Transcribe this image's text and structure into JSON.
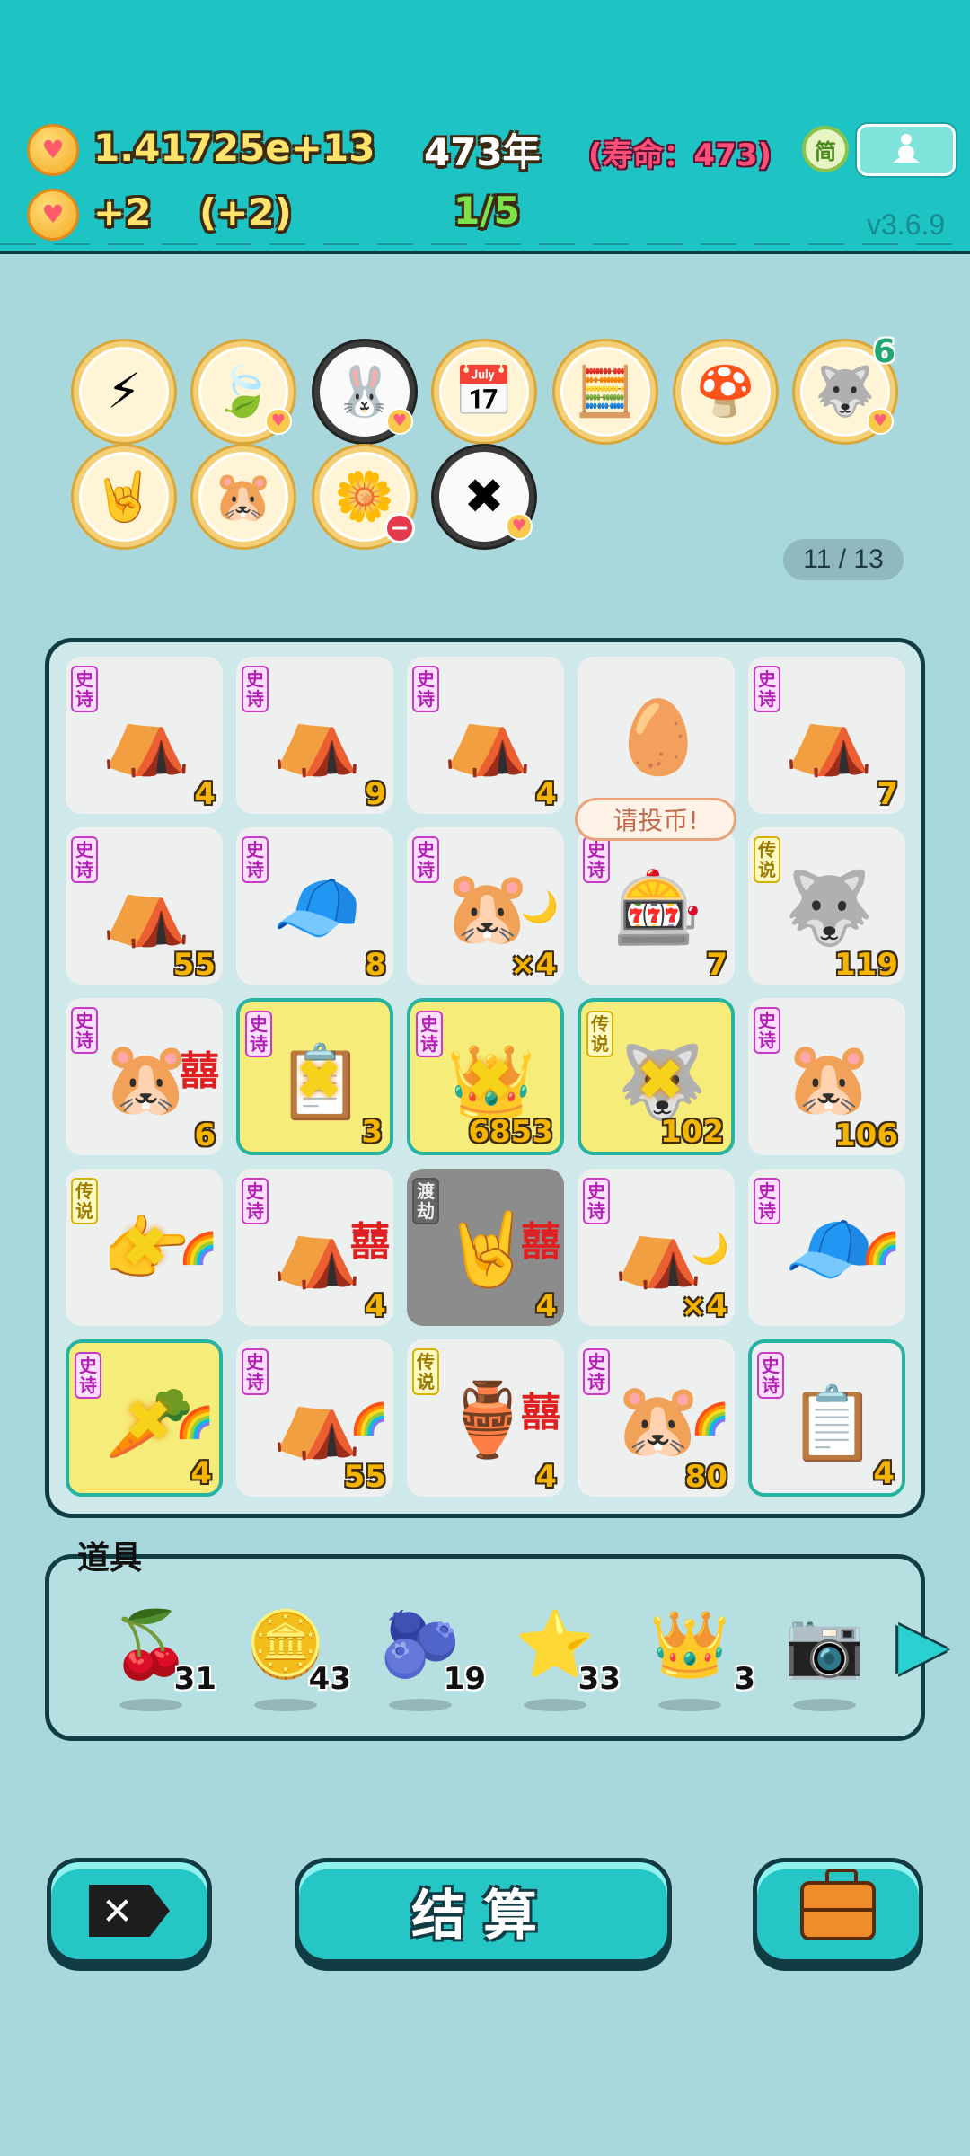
{
  "header": {
    "coins": "1.41725e+13",
    "year": "473年",
    "lifespan": "(寿命：473)",
    "income": "+2",
    "income_bonus": "(+2)",
    "progress": "1/5",
    "simp_label": "简",
    "version": "v3.6.9"
  },
  "buffs": {
    "page": "11 / 13",
    "items": [
      {
        "icon": "lightning-icon",
        "glyph": "⚡"
      },
      {
        "icon": "leaf-icon",
        "glyph": "🍃"
      },
      {
        "icon": "rabbit-icon",
        "glyph": "🐰"
      },
      {
        "icon": "calendar-icon",
        "glyph": "📅"
      },
      {
        "icon": "math-face-icon",
        "glyph": "🧮"
      },
      {
        "icon": "mushroom-cup-icon",
        "glyph": "🍄"
      },
      {
        "icon": "husky-icon",
        "glyph": "🐺",
        "count": "6"
      },
      {
        "icon": "rock-hand-icon",
        "glyph": "🤘"
      },
      {
        "icon": "gophers-icon",
        "glyph": "🐹"
      },
      {
        "icon": "flower-pot-icon",
        "glyph": "🌼"
      },
      {
        "icon": "delete-tag-icon",
        "glyph": "✖"
      }
    ]
  },
  "board": {
    "tooltip": "请投币!",
    "tags": {
      "epic": "史诗",
      "legend": "传说",
      "robbery": "渡劫"
    },
    "cells": [
      {
        "tag": "epic",
        "icon": "tent-rabbit-icon",
        "glyph": "⛺",
        "num": "4"
      },
      {
        "tag": "epic",
        "icon": "tent-rabbit-icon",
        "glyph": "⛺",
        "num": "9"
      },
      {
        "tag": "epic",
        "icon": "tent-rabbit-icon",
        "glyph": "⛺",
        "num": "4"
      },
      {
        "tag": "",
        "icon": "egg-icon",
        "glyph": "🥚",
        "num": ""
      },
      {
        "tag": "epic",
        "icon": "tent-rabbit-icon",
        "glyph": "⛺",
        "num": "7"
      },
      {
        "tag": "epic",
        "icon": "tent-rabbit-icon",
        "glyph": "⛺",
        "num": "55"
      },
      {
        "tag": "epic",
        "icon": "green-hat-man-icon",
        "glyph": "🧢",
        "num": "8"
      },
      {
        "tag": "epic",
        "icon": "gopher-icon",
        "glyph": "🐹",
        "num": "×4",
        "deco": "🌙"
      },
      {
        "tag": "epic",
        "icon": "gacha-machine-icon",
        "glyph": "🎰",
        "num": "7"
      },
      {
        "tag": "legend",
        "icon": "husky-king-icon",
        "glyph": "🐺",
        "num": "119"
      },
      {
        "tag": "epic",
        "icon": "gopher-icon",
        "glyph": "🐹",
        "num": "6",
        "red": "囍"
      },
      {
        "tag": "epic",
        "icon": "copy-paste-icon",
        "glyph": "📋",
        "num": "3",
        "hl": true,
        "x": true
      },
      {
        "tag": "epic",
        "icon": "green-hat-king-icon",
        "glyph": "👑",
        "num": "6853",
        "hl": true,
        "x": true
      },
      {
        "tag": "legend",
        "icon": "husky-king-icon",
        "glyph": "🐺",
        "num": "102",
        "hl": true,
        "x": true
      },
      {
        "tag": "epic",
        "icon": "gopher-icon",
        "glyph": "🐹",
        "num": "106"
      },
      {
        "tag": "legend",
        "icon": "pointing-hand-icon",
        "glyph": "👉",
        "num": "",
        "deco": "🌈",
        "x": true
      },
      {
        "tag": "epic",
        "icon": "tent-rabbit-icon",
        "glyph": "⛺",
        "num": "4",
        "red": "囍"
      },
      {
        "tag": "robbery",
        "icon": "rock-hand-icon",
        "glyph": "🤘",
        "num": "4",
        "dark": true,
        "red": "囍"
      },
      {
        "tag": "epic",
        "icon": "tent-rabbit-icon",
        "glyph": "⛺",
        "num": "×4",
        "deco": "🌙"
      },
      {
        "tag": "epic",
        "icon": "green-hat-man-icon",
        "glyph": "🧢",
        "num": "",
        "deco": "🌈"
      },
      {
        "tag": "epic",
        "icon": "carrot-icon",
        "glyph": "🥕",
        "num": "4",
        "hl": true,
        "x": true,
        "deco": "🌈"
      },
      {
        "tag": "epic",
        "icon": "tent-rabbit-icon",
        "glyph": "⛺",
        "num": "55",
        "deco": "🌈"
      },
      {
        "tag": "legend",
        "icon": "jade-vase-icon",
        "glyph": "🏺",
        "num": "4",
        "red": "囍"
      },
      {
        "tag": "epic",
        "icon": "gopher-icon",
        "glyph": "🐹",
        "num": "80",
        "deco": "🌈"
      },
      {
        "tag": "epic",
        "icon": "copy-paste-icon",
        "glyph": "📋",
        "num": "4",
        "outline": true
      }
    ]
  },
  "items": {
    "title": "道具",
    "list": [
      {
        "icon": "lychee-icon",
        "glyph": "🍒",
        "count": "31"
      },
      {
        "icon": "dollar-coin-icon",
        "glyph": "🪙",
        "count": "43"
      },
      {
        "icon": "blueberry-icon",
        "glyph": "🫐",
        "count": "19"
      },
      {
        "icon": "star-icon",
        "glyph": "⭐",
        "count": "33"
      },
      {
        "icon": "crown-icon",
        "glyph": "👑",
        "count": "3"
      },
      {
        "icon": "camera-icon",
        "glyph": "📷",
        "count": ""
      }
    ]
  },
  "footer": {
    "settle_label": "结算"
  }
}
